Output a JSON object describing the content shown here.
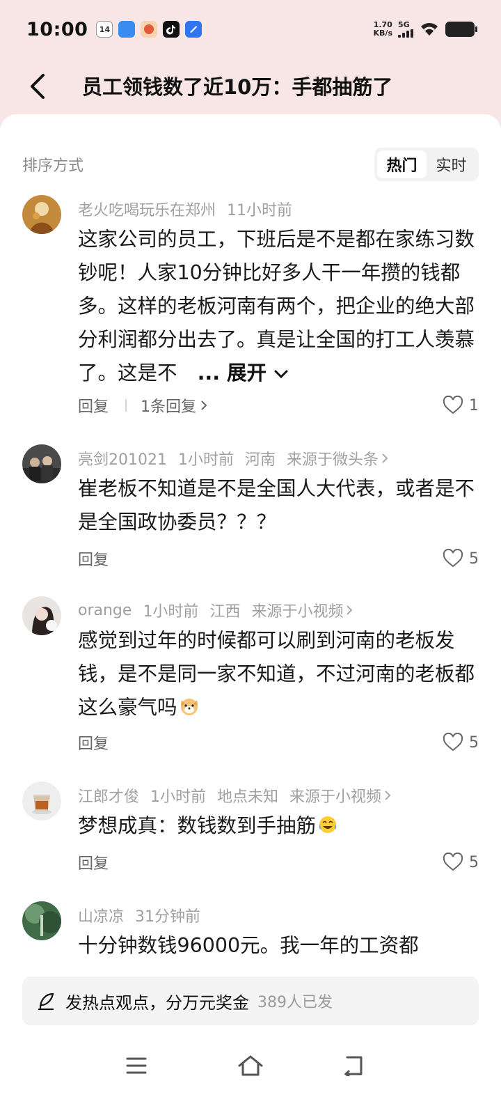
{
  "status_bar": {
    "time": "10:00",
    "app_icons": [
      "calendar-icon",
      "files-icon",
      "shop-icon",
      "tiktok-icon",
      "app-icon"
    ],
    "calendar_day": "14",
    "speed_value": "1.70",
    "speed_unit": "KB/s",
    "network": "5G",
    "colors": {
      "accent": "#f8e6e6"
    }
  },
  "header": {
    "title": "员工领钱数了近10万：手都抽筋了"
  },
  "sort": {
    "label": "排序方式",
    "options": [
      "热门",
      "实时"
    ],
    "selected": "热门"
  },
  "comments": [
    {
      "user": "老火吃喝玩乐在郑州",
      "time": "11小时前",
      "location": "",
      "source": "",
      "text": "这家公司的员工，下班后是不是都在家练习数钞呢！人家10分钟比好多人干一年攒的钱都多。这样的老板河南有两个，把企业的绝大部分利润都分出去了。真是让全国的打工人羡慕了。这是不",
      "expand_label": "... 展开",
      "reply_label": "回复",
      "replies_label": "1条回复",
      "likes": "1"
    },
    {
      "user": "亮剑201021",
      "time": "1小时前",
      "location": "河南",
      "source": "来源于微头条",
      "text": "崔老板不知道是不是全国人大代表，或者是不是全国政协委员？？？",
      "reply_label": "回复",
      "likes": "5"
    },
    {
      "user": "orange",
      "time": "1小时前",
      "location": "江西",
      "source": "来源于小视频",
      "text": "感觉到过年的时候都可以刷到河南的老板发钱，是不是同一家不知道，不过河南的老板都这么豪气吗",
      "emoji": "dog-emoji",
      "reply_label": "回复",
      "likes": "5"
    },
    {
      "user": "江郎才俊",
      "time": "1小时前",
      "location": "地点未知",
      "source": "来源于小视频",
      "text": "梦想成真：数钱数到手抽筋",
      "emoji": "crying-laughing-emoji",
      "reply_label": "回复",
      "likes": "5"
    },
    {
      "user": "山凉凉",
      "time": "31分钟前",
      "text": "十分钟数钱96000元。我一年的工资都"
    }
  ],
  "post_bar": {
    "text": "发热点观点，分万元奖金",
    "count": "389人已发"
  },
  "navbar": {
    "icons": [
      "menu-icon",
      "home-icon",
      "back-nav-icon"
    ]
  }
}
